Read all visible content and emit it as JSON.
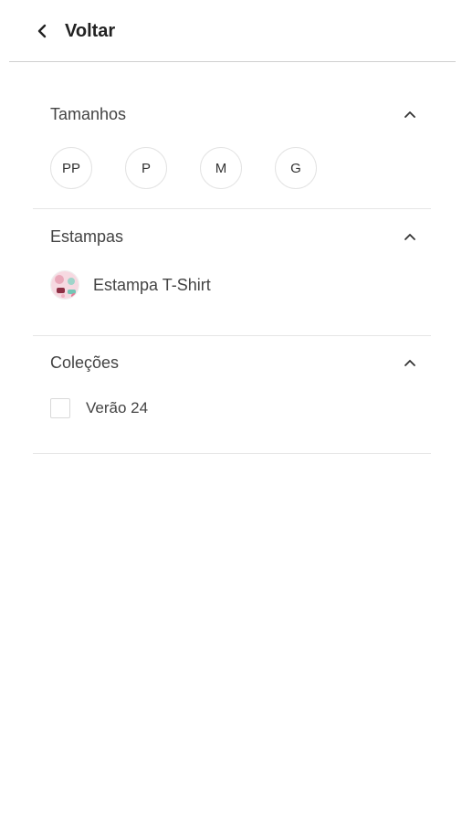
{
  "header": {
    "back_label": "Voltar",
    "back_icon": "chevron-left-icon"
  },
  "sections": {
    "sizes": {
      "title": "Tamanhos",
      "expanded": true,
      "options": [
        "PP",
        "P",
        "M",
        "G"
      ]
    },
    "prints": {
      "title": "Estampas",
      "expanded": true,
      "items": [
        {
          "label": "Estampa T-Shirt",
          "thumb_icon": "print-swatch-icon"
        }
      ]
    },
    "collections": {
      "title": "Coleções",
      "expanded": true,
      "items": [
        {
          "label": "Verão 24",
          "checked": false
        }
      ]
    }
  },
  "colors": {
    "text": "#444444",
    "divider": "#e6e6e6",
    "header_divider": "#cfcfcf"
  }
}
